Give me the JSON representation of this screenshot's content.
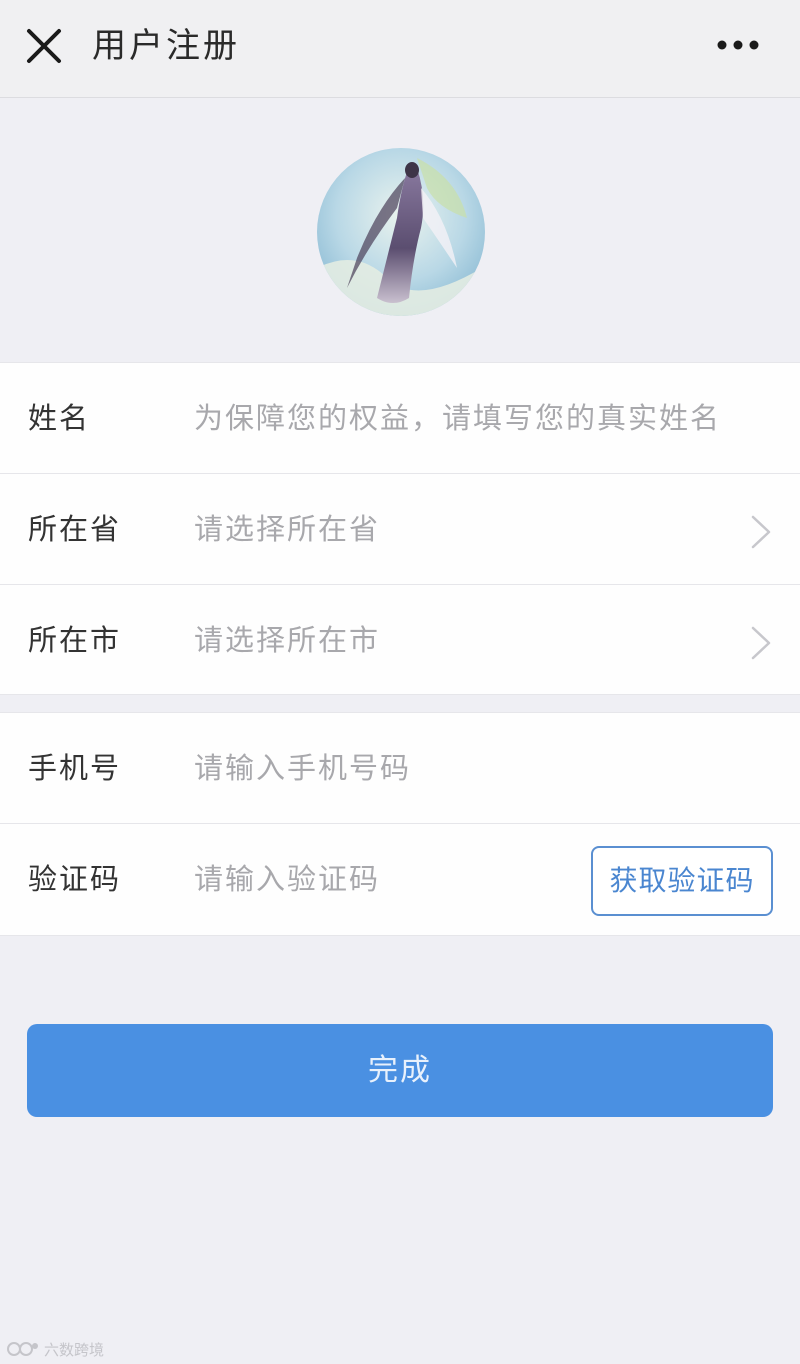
{
  "header": {
    "title": "用户注册",
    "close_icon": "close-icon",
    "more_icon": "more-horizontal-icon"
  },
  "avatar": {
    "description_icon": "avatar-image"
  },
  "form": {
    "name": {
      "label": "姓名",
      "placeholder": "为保障您的权益，请填写您的真实姓名"
    },
    "province": {
      "label": "所在省",
      "placeholder": "请选择所在省"
    },
    "city": {
      "label": "所在市",
      "placeholder": "请选择所在市"
    },
    "phone": {
      "label": "手机号",
      "placeholder": "请输入手机号码"
    },
    "code": {
      "label": "验证码",
      "placeholder": "请输入验证码",
      "button_label": "获取验证码"
    }
  },
  "submit": {
    "label": "完成"
  },
  "watermark": {
    "text": "六数跨境"
  },
  "colors": {
    "primary": "#4a90e2",
    "background": "#efeff4",
    "placeholder": "#a8a8ac",
    "code_button_border": "#5a8fd1"
  }
}
